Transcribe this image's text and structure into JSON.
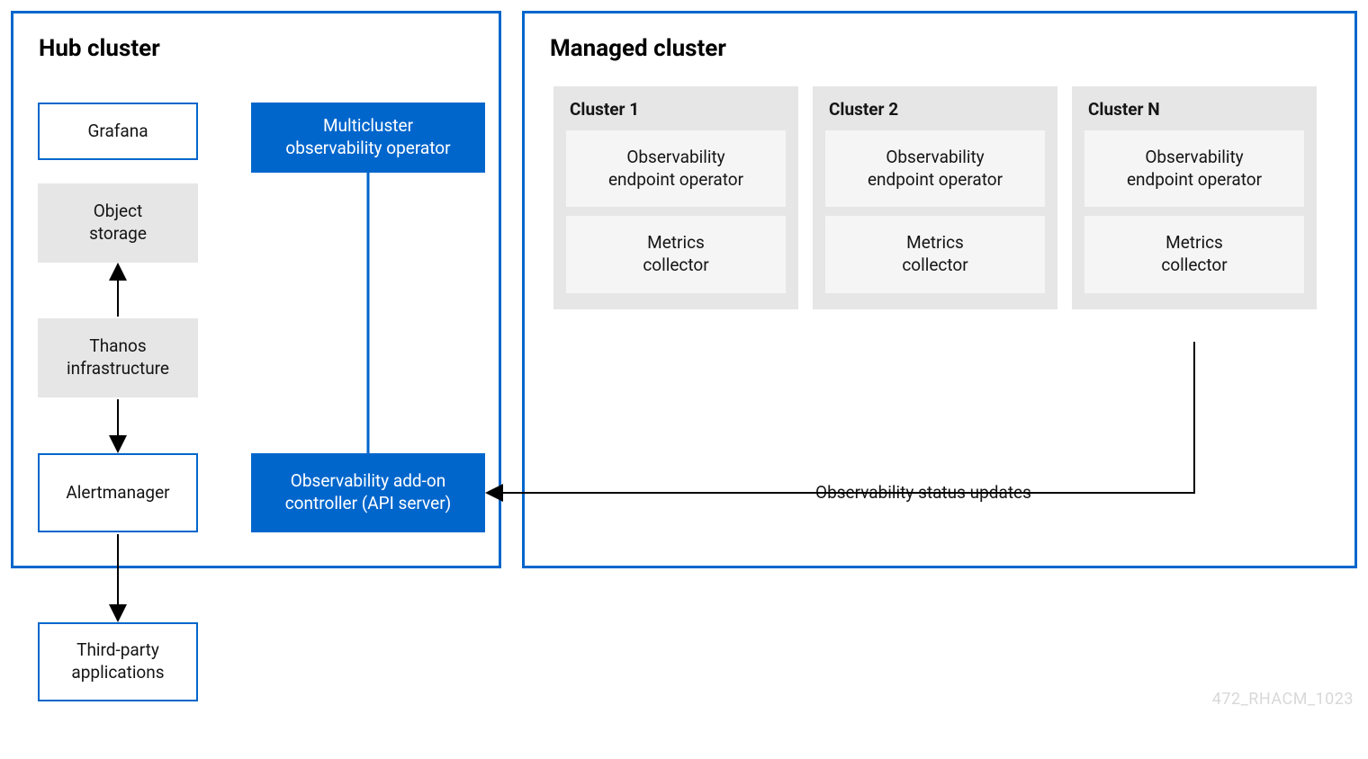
{
  "hub": {
    "title": "Hub cluster",
    "grafana": "Grafana",
    "object_storage": "Object\nstorage",
    "thanos": "Thanos\ninfrastructure",
    "alertmanager": "Alertmanager",
    "multicluster_operator": "Multicluster\nobservability operator",
    "addon_controller": "Observability add-on\ncontroller (API server)"
  },
  "managed": {
    "title": "Managed cluster",
    "clusters": [
      {
        "name": "Cluster 1",
        "endpoint": "Observability\nendpoint operator",
        "collector": "Metrics\ncollector"
      },
      {
        "name": "Cluster 2",
        "endpoint": "Observability\nendpoint operator",
        "collector": "Metrics\ncollector"
      },
      {
        "name": "Cluster N",
        "endpoint": "Observability\nendpoint operator",
        "collector": "Metrics\ncollector"
      }
    ]
  },
  "third_party": "Third-party\napplications",
  "status_label": "Observability status updates",
  "footer": "472_RHACM_1023",
  "colors": {
    "blue": "#0066cc",
    "gray": "#e6e6e6",
    "light_gray": "#f5f5f5"
  }
}
